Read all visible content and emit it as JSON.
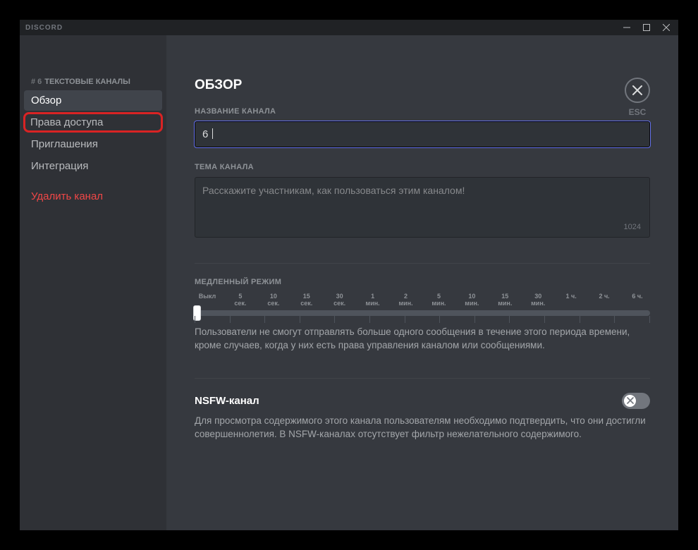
{
  "titlebar": {
    "brand": "DISCORD"
  },
  "sidebar": {
    "header_prefix": "# 6",
    "header_label": "ТЕКСТОВЫЕ КАНАЛЫ",
    "items": [
      {
        "label": "Обзор"
      },
      {
        "label": "Права доступа"
      },
      {
        "label": "Приглашения"
      },
      {
        "label": "Интеграция"
      }
    ],
    "delete_label": "Удалить канал"
  },
  "main": {
    "title": "ОБЗОР",
    "channel_name": {
      "label": "НАЗВАНИЕ КАНАЛА",
      "value": "6"
    },
    "channel_topic": {
      "label": "ТЕМА КАНАЛА",
      "placeholder": "Расскажите участникам, как пользоваться этим каналом!",
      "counter": "1024"
    },
    "slowmode": {
      "label": "МЕДЛЕННЫЙ РЕЖИМ",
      "ticks": [
        "Выкл",
        "5\nсек.",
        "10\nсек.",
        "15\nсек.",
        "30\nсек.",
        "1\nмин.",
        "2\nмин.",
        "5\nмин.",
        "10\nмин.",
        "15\nмин.",
        "30\nмин.",
        "1 ч.",
        "2 ч.",
        "6 ч."
      ],
      "help": "Пользователи не смогут отправлять больше одного сообщения в течение этого периода времени, кроме случаев, когда у них есть права управления каналом или сообщениями."
    },
    "nsfw": {
      "title": "NSFW-канал",
      "help": "Для просмотра содержимого этого канала пользователям необходимо подтвердить, что они достигли совершеннолетия. В NSFW-каналах отсутствует фильтр нежелательного содержимого."
    },
    "close": {
      "esc": "ESC"
    }
  }
}
